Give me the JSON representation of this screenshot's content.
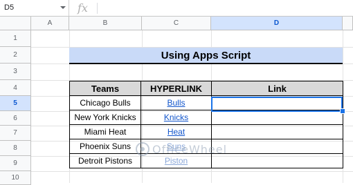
{
  "formula_bar": {
    "cell_ref": "D5",
    "fx_label": "fx",
    "content": ""
  },
  "columns": [
    "A",
    "B",
    "C",
    "D"
  ],
  "rows": [
    "1",
    "2",
    "3",
    "4",
    "5",
    "6",
    "7",
    "8",
    "9",
    "10"
  ],
  "selected": {
    "column": "D",
    "row": "5"
  },
  "sheet": {
    "title": "Using Apps Script",
    "headers": [
      "Teams",
      "HYPERLINK",
      "Link"
    ],
    "data": [
      {
        "team": "Chicago Bulls",
        "hyperlink": "Bulls",
        "link": ""
      },
      {
        "team": "New York Knicks",
        "hyperlink": "Knicks",
        "link": ""
      },
      {
        "team": "Miami Heat",
        "hyperlink": "Heat",
        "link": ""
      },
      {
        "team": "Phoenix Suns",
        "hyperlink": "Suns",
        "link": ""
      },
      {
        "team": "Detroit Pistons",
        "hyperlink": "Piston",
        "link": ""
      }
    ]
  },
  "watermark": {
    "text": "OfficeWheel"
  },
  "colors": {
    "title_fill": "#c9daf8",
    "header_fill": "#d9d9d9",
    "link": "#1155cc",
    "selection": "#1a73e8"
  }
}
